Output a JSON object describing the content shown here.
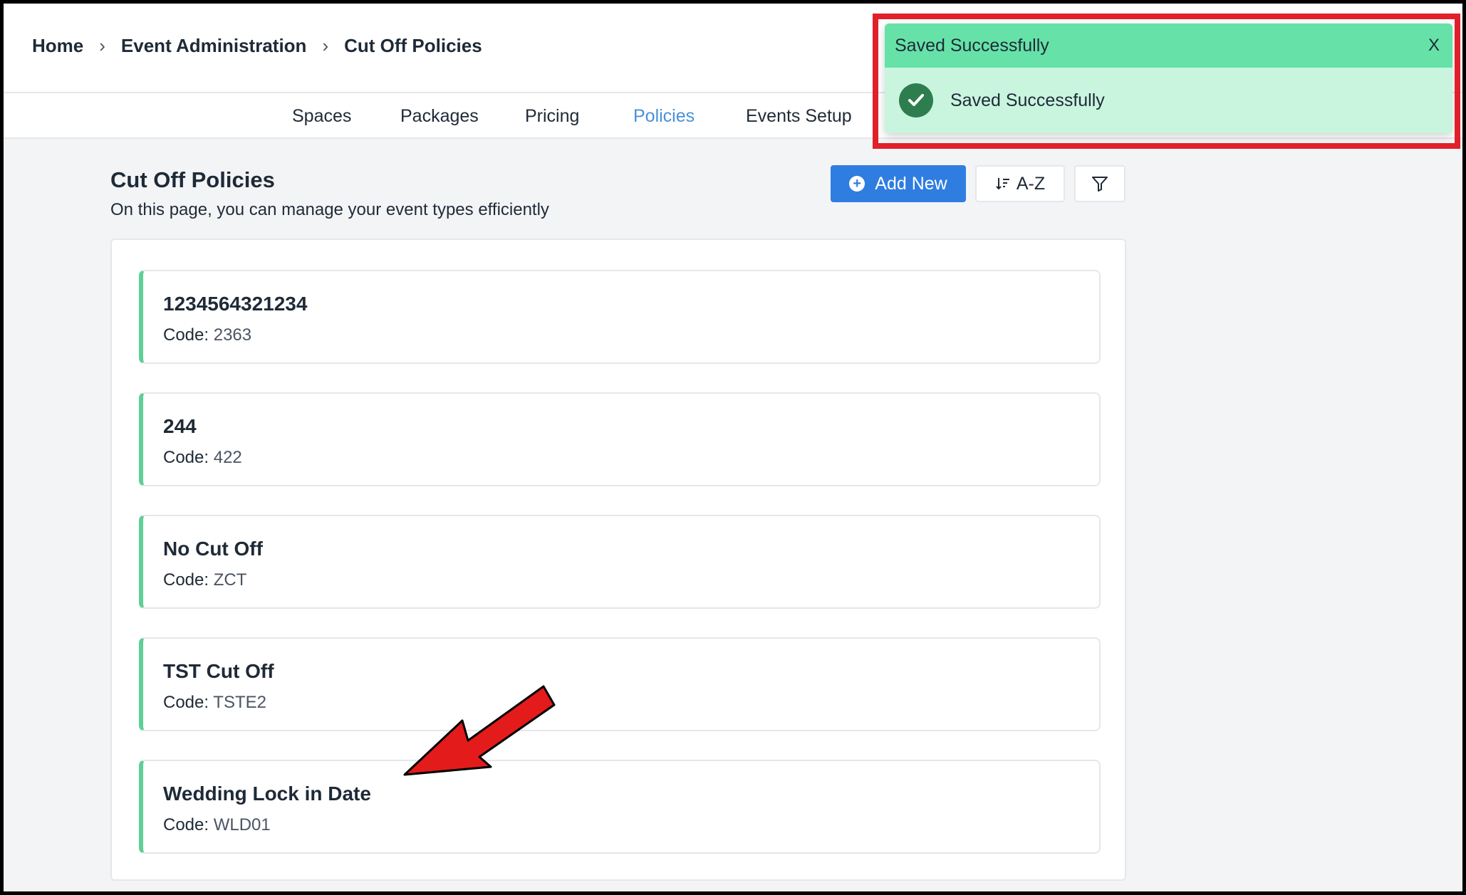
{
  "breadcrumb": {
    "items": [
      "Home",
      "Event Administration",
      "Cut Off Policies"
    ]
  },
  "nav": {
    "tabs": [
      "Spaces",
      "Packages",
      "Pricing",
      "Policies",
      "Events Setup"
    ],
    "active": "Policies"
  },
  "page": {
    "title": "Cut Off Policies",
    "subtitle": "On this page, you can manage your event types efficiently"
  },
  "toolbar": {
    "add_label": "Add New",
    "sort_label": "A-Z"
  },
  "policies": [
    {
      "name": "1234564321234",
      "code_label": "Code:",
      "code": "2363"
    },
    {
      "name": "244",
      "code_label": "Code:",
      "code": "422"
    },
    {
      "name": "No Cut Off",
      "code_label": "Code:",
      "code": "ZCT"
    },
    {
      "name": "TST Cut Off",
      "code_label": "Code:",
      "code": "TSTE2"
    },
    {
      "name": "Wedding Lock in Date",
      "code_label": "Code:",
      "code": "WLD01"
    }
  ],
  "toast": {
    "header": "Saved Successfully",
    "message": "Saved Successfully",
    "close_symbol": "X"
  },
  "colors": {
    "accent": "#2f7de1",
    "active_tab": "#4a90d9",
    "card_bar": "#5fcf94",
    "toast_head": "#66e2a8",
    "toast_body": "#c9f5df",
    "highlight": "#e0202a",
    "arrow": "#e31b1b"
  }
}
